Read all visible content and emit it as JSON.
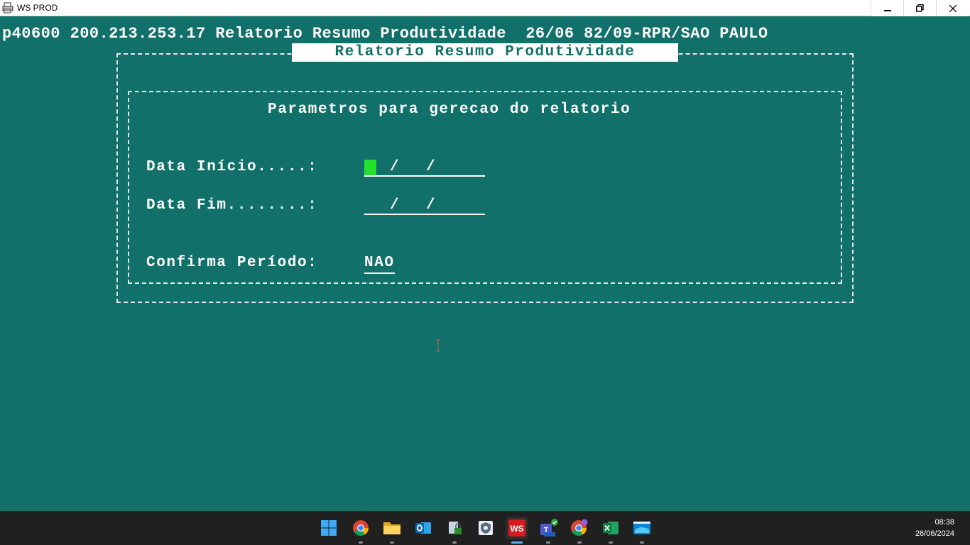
{
  "window": {
    "title": "WS PROD",
    "icon": "printer-icon"
  },
  "terminal": {
    "header_line": "p40600 200.213.253.17 Relatorio Resumo Produtividade  26/06 82/09-RPR/SAO PAULO",
    "box_title": "Relatorio Resumo Produtividade",
    "section_title": "Parametros para gerecao do relatorio",
    "fields": {
      "data_inicio_label": "Data Início.....:",
      "data_inicio_slash1": "/",
      "data_inicio_slash2": "/",
      "data_fim_label": "Data Fim........:",
      "data_fim_slash1": "/",
      "data_fim_slash2": "/",
      "confirma_label": "Confirma Período:",
      "confirma_value": "NAO"
    },
    "colors": {
      "background": "#12706a",
      "text": "#ffffff",
      "cursor": "#22e22c"
    }
  },
  "taskbar": {
    "icons": [
      "windows-start-icon",
      "chrome-icon",
      "file-explorer-icon",
      "outlook-icon",
      "lock-file-icon",
      "shield-app-icon",
      "ws-app-icon",
      "teams-new-icon",
      "chrome-profile-icon",
      "excel-icon",
      "remote-desktop-icon"
    ],
    "clock_time": "08:38",
    "clock_date": "26/06/2024"
  }
}
